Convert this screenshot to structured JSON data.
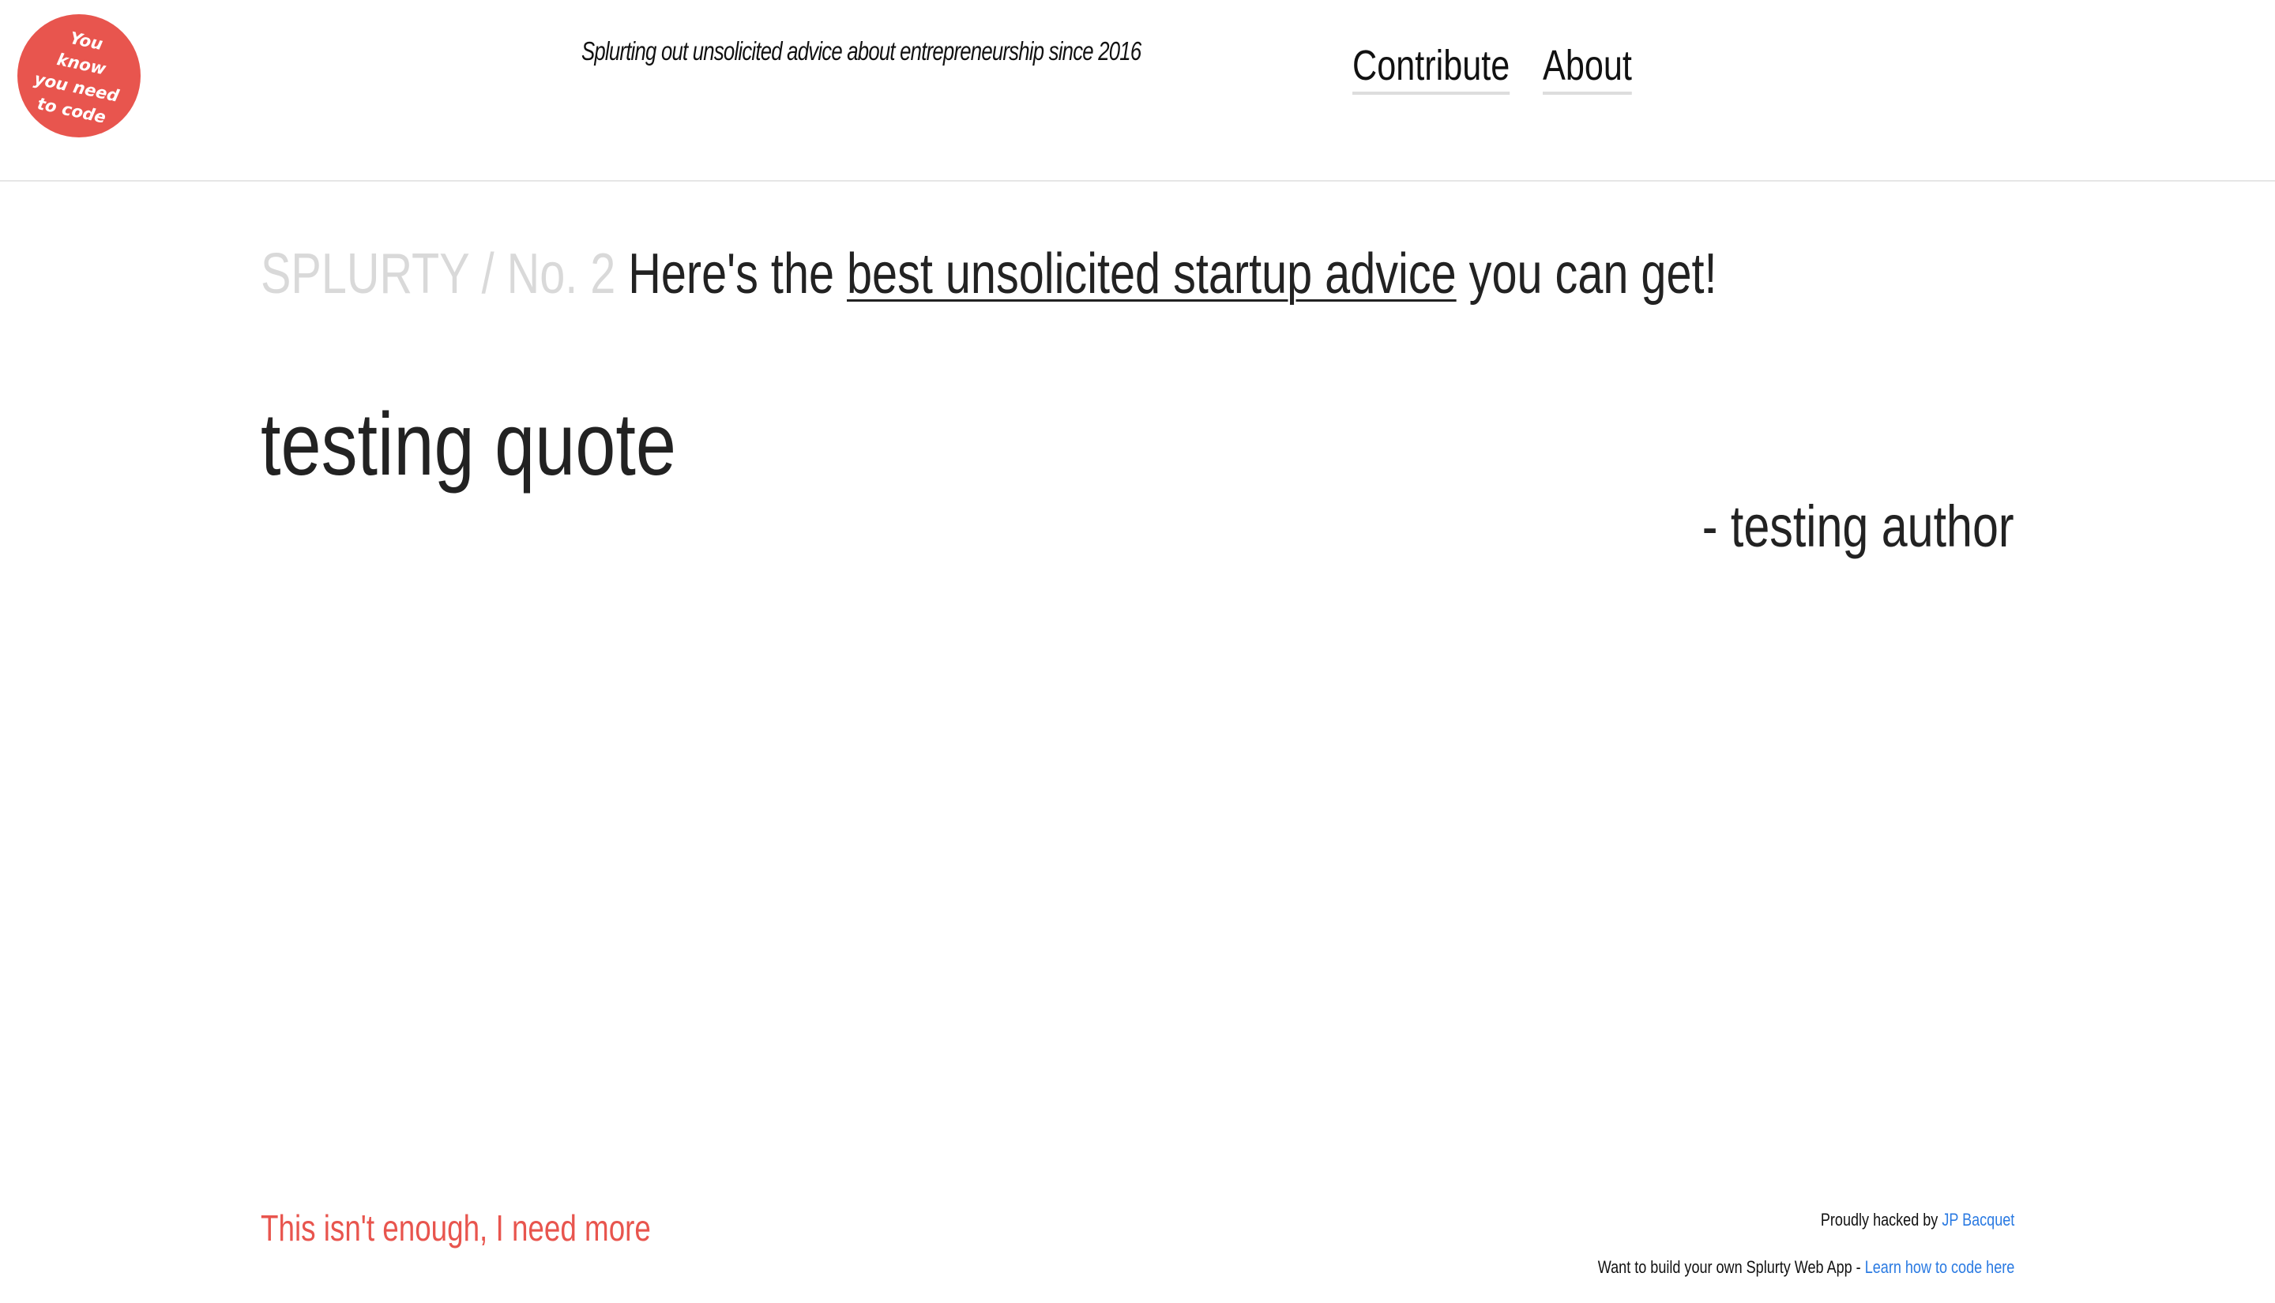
{
  "header": {
    "badge_text": "You know you need to code",
    "tagline": "Splurting out unsolicited advice about entrepreneurship since 2016",
    "nav": {
      "contribute": "Contribute",
      "about": "About"
    }
  },
  "headline": {
    "issue": "SPLURTY / No. 2",
    "prefix": "Here's the",
    "link_text": "best unsolicited startup advice",
    "suffix": "you can get!"
  },
  "quote": {
    "text": "testing quote",
    "author": "- testing author"
  },
  "footer": {
    "more_link": "This isn't enough, I need more",
    "hacked_prefix": "Proudly hacked by",
    "hacked_link": "JP Bacquet",
    "build_prefix": "Want to build your own Splurty Web App -",
    "build_link": "Learn how to code here"
  },
  "colors": {
    "accent": "#e8554e",
    "link": "#2a7ae2",
    "issue_gray": "#d9d9d9",
    "text": "#222222"
  }
}
